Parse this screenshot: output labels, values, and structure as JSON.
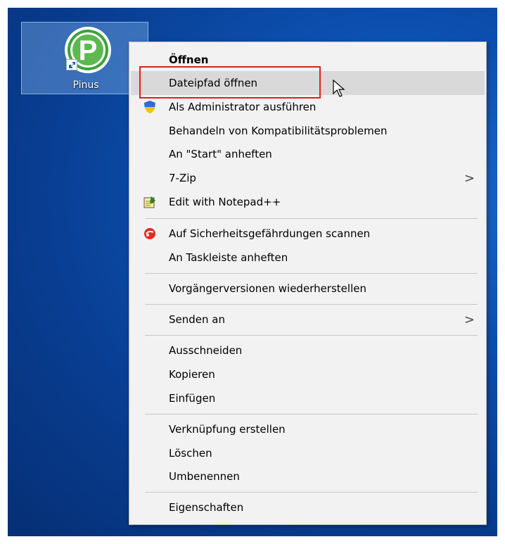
{
  "desktop": {
    "icon_label": "Pinus",
    "app_logo_letter": "P"
  },
  "menu": {
    "items": [
      {
        "label": "Öffnen"
      },
      {
        "label": "Dateipfad öffnen"
      },
      {
        "label": "Als Administrator ausführen"
      },
      {
        "label": "Behandeln von Kompatibilitätsproblemen"
      },
      {
        "label": "An \"Start\" anheften"
      },
      {
        "label": "7-Zip"
      },
      {
        "label": "Edit with Notepad++"
      },
      {
        "label": "Auf Sicherheitsgefährdungen scannen"
      },
      {
        "label": "An Taskleiste anheften"
      },
      {
        "label": "Vorgängerversionen wiederherstellen"
      },
      {
        "label": "Senden an"
      },
      {
        "label": "Ausschneiden"
      },
      {
        "label": "Kopieren"
      },
      {
        "label": "Einfügen"
      },
      {
        "label": "Verknüpfung erstellen"
      },
      {
        "label": "Löschen"
      },
      {
        "label": "Umbenennen"
      },
      {
        "label": "Eigenschaften"
      }
    ],
    "submenu_glyph": ">"
  },
  "colors": {
    "highlight_border": "#e0201a",
    "hover_bg": "#d9d9d9",
    "menu_bg": "#f2f2f2",
    "app_green": "#3ea23a"
  },
  "icons": {
    "administrator": "shield-icon",
    "notepad": "notepad-icon",
    "scan": "security-scan-icon"
  }
}
